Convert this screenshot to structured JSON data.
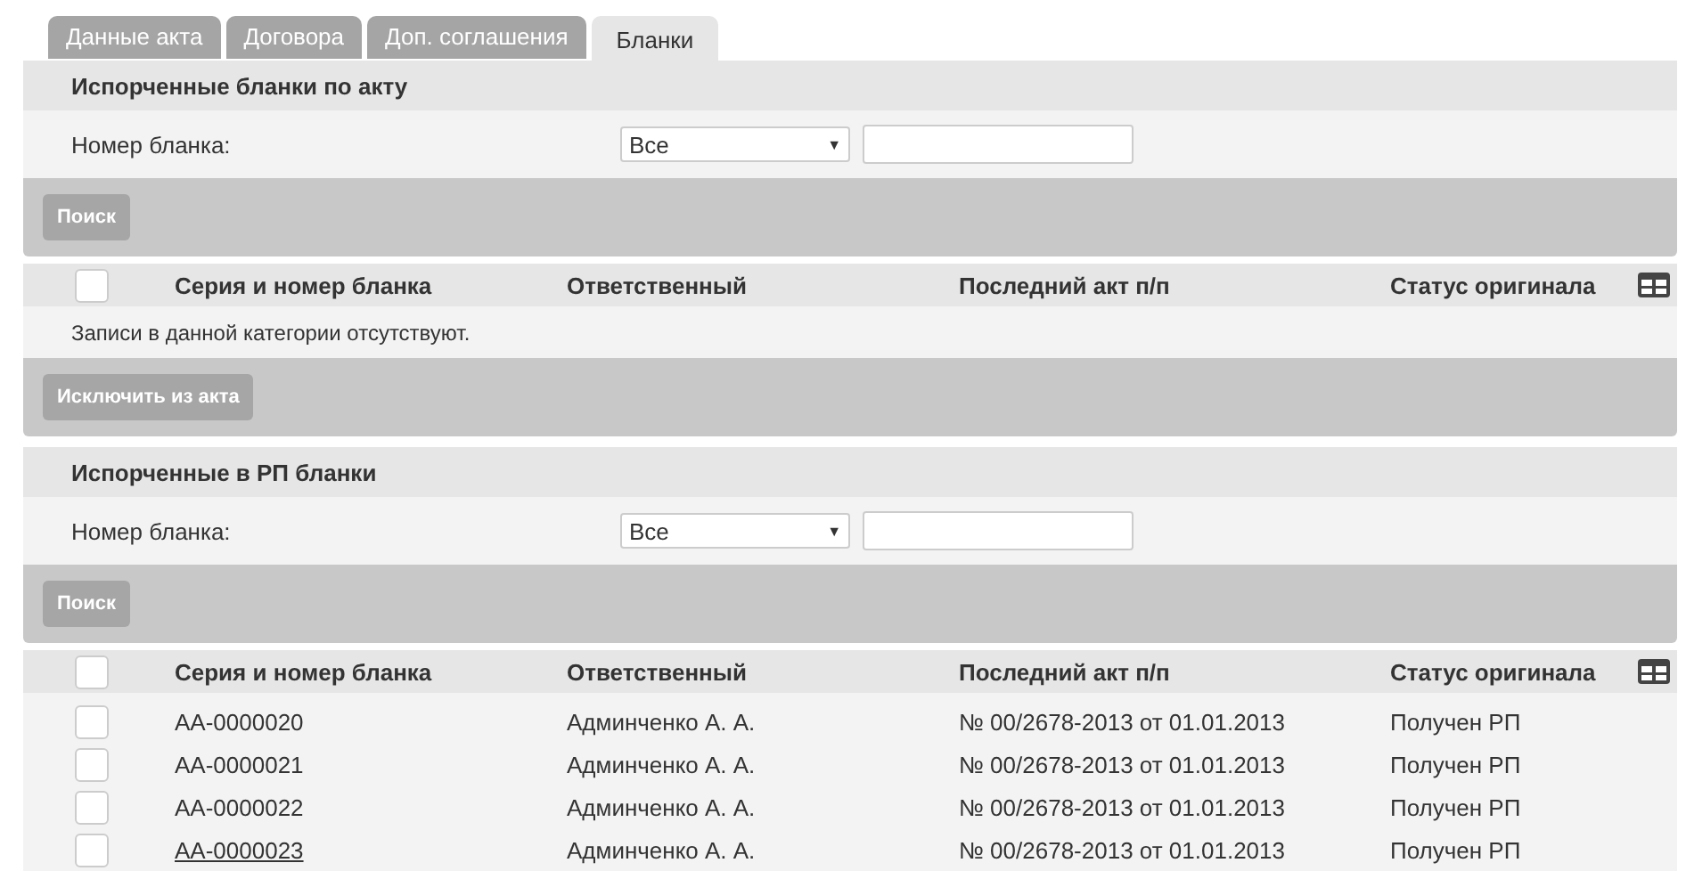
{
  "tabs": [
    {
      "label": "Данные акта",
      "selected": false
    },
    {
      "label": "Договора",
      "selected": false
    },
    {
      "label": "Доп. соглашения",
      "selected": false
    },
    {
      "label": "Бланки",
      "selected": true
    }
  ],
  "sections": [
    {
      "title": "Испорченные бланки по акту",
      "filter": {
        "label": "Номер бланка:",
        "select_value": "Все",
        "arrow": "▼"
      },
      "search_button": "Поиск",
      "table": {
        "select_all_checked": false,
        "columns": [
          "Серия и номер бланка",
          "Ответственный",
          "Последний акт п/п",
          "Статус оригинала"
        ],
        "empty_message": "Записи в данной категории отсутствуют."
      },
      "action_button": "Исключить из акта"
    },
    {
      "title": "Испорченные в РП бланки",
      "filter": {
        "label": "Номер бланка:",
        "select_value": "Все",
        "arrow": "▼"
      },
      "search_button": "Поиск",
      "table": {
        "select_all_checked": false,
        "columns": [
          "Серия и номер бланка",
          "Ответственный",
          "Последний акт п/п",
          "Статус оригинала"
        ],
        "rows": [
          {
            "checked": false,
            "linked": false,
            "cells": [
              "АА-0000020",
              "Админченко А. А.",
              "№ 00/2678-2013 от 01.01.2013",
              "Получен РП"
            ]
          },
          {
            "checked": false,
            "linked": false,
            "cells": [
              "АА-0000021",
              "Админченко А. А.",
              "№ 00/2678-2013 от 01.01.2013",
              "Получен РП"
            ]
          },
          {
            "checked": false,
            "linked": false,
            "cells": [
              "АА-0000022",
              "Админченко А. А.",
              "№ 00/2678-2013 от 01.01.2013",
              "Получен РП"
            ]
          },
          {
            "checked": false,
            "linked": true,
            "cells": [
              "АА-0000023",
              "Админченко А. А.",
              "№ 00/2678-2013 от 01.01.2013",
              "Получен РП"
            ]
          }
        ]
      }
    }
  ]
}
